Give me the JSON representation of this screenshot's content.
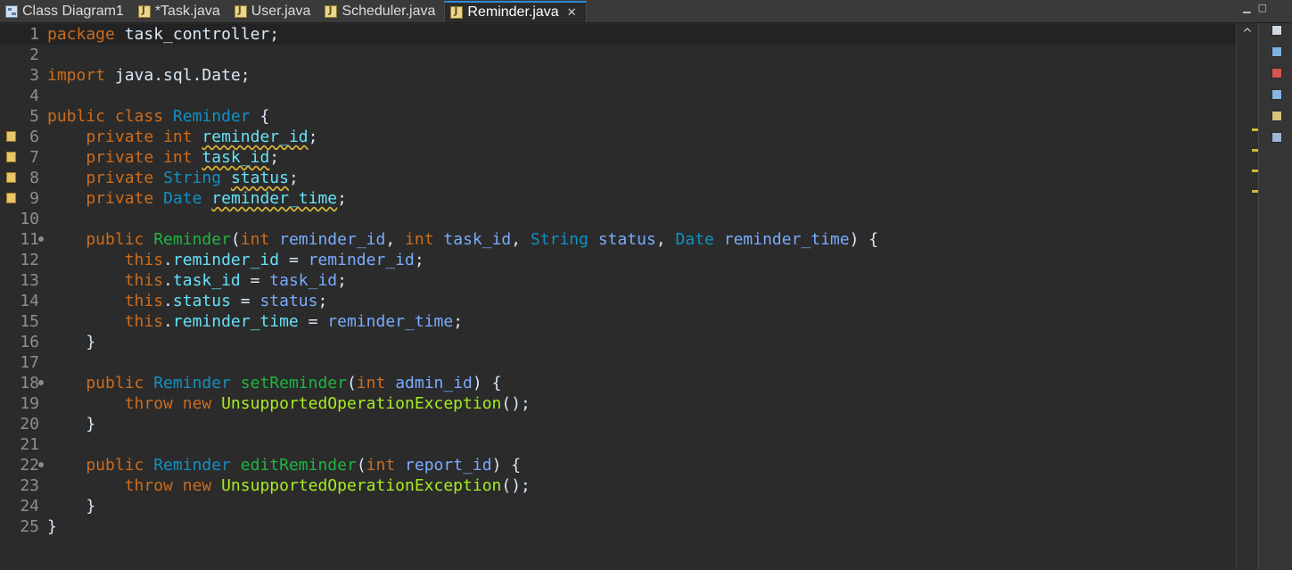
{
  "tabs": [
    {
      "label": "Class Diagram1",
      "icon": "class-diagram-icon",
      "active": false
    },
    {
      "label": "*Task.java",
      "icon": "java-file-icon",
      "active": false
    },
    {
      "label": "User.java",
      "icon": "java-file-icon",
      "active": false
    },
    {
      "label": "Scheduler.java",
      "icon": "java-file-icon",
      "active": false
    },
    {
      "label": "Reminder.java",
      "icon": "java-file-icon",
      "active": true,
      "close": "✕"
    }
  ],
  "colors": {
    "background": "#2b2b2b",
    "keyword": "#cc6c1d",
    "type": "#1290c3",
    "method": "#1eb540",
    "field": "#66e1f8",
    "parameter": "#79abff",
    "exception": "#a7ec21",
    "text": "#d9e8f7",
    "active_tab_accent": "#2f8ad8"
  },
  "editor": {
    "file": "Reminder.java",
    "lines": [
      {
        "n": "1",
        "tokens": [
          {
            "t": "package",
            "c": "kw"
          },
          {
            "t": " task_controller;",
            "c": "plain"
          }
        ]
      },
      {
        "n": "2",
        "tokens": []
      },
      {
        "n": "3",
        "tokens": [
          {
            "t": "import",
            "c": "kw"
          },
          {
            "t": " java.sql.Date;",
            "c": "plain"
          }
        ]
      },
      {
        "n": "4",
        "tokens": []
      },
      {
        "n": "5",
        "tokens": [
          {
            "t": "public",
            "c": "kw"
          },
          {
            "t": " ",
            "c": "plain"
          },
          {
            "t": "class",
            "c": "kw"
          },
          {
            "t": " ",
            "c": "plain"
          },
          {
            "t": "Reminder",
            "c": "ty"
          },
          {
            "t": " {",
            "c": "plain"
          }
        ]
      },
      {
        "n": "6",
        "marker": "warning",
        "tokens": [
          {
            "t": "    private",
            "c": "kw"
          },
          {
            "t": " ",
            "c": "plain"
          },
          {
            "t": "int",
            "c": "kw"
          },
          {
            "t": " ",
            "c": "plain"
          },
          {
            "t": "reminder_id",
            "c": "fld",
            "w": true
          },
          {
            "t": ";",
            "c": "plain"
          }
        ]
      },
      {
        "n": "7",
        "marker": "warning",
        "tokens": [
          {
            "t": "    private",
            "c": "kw"
          },
          {
            "t": " ",
            "c": "plain"
          },
          {
            "t": "int",
            "c": "kw"
          },
          {
            "t": " ",
            "c": "plain"
          },
          {
            "t": "task_id",
            "c": "fld",
            "w": true
          },
          {
            "t": ";",
            "c": "plain"
          }
        ]
      },
      {
        "n": "8",
        "marker": "warning",
        "tokens": [
          {
            "t": "    private",
            "c": "kw"
          },
          {
            "t": " ",
            "c": "plain"
          },
          {
            "t": "String",
            "c": "ty"
          },
          {
            "t": " ",
            "c": "plain"
          },
          {
            "t": "status",
            "c": "fld",
            "w": true
          },
          {
            "t": ";",
            "c": "plain"
          }
        ]
      },
      {
        "n": "9",
        "marker": "warning",
        "tokens": [
          {
            "t": "    private",
            "c": "kw"
          },
          {
            "t": " ",
            "c": "plain"
          },
          {
            "t": "Date",
            "c": "ty"
          },
          {
            "t": " ",
            "c": "plain"
          },
          {
            "t": "reminder_time",
            "c": "fld",
            "w": true
          },
          {
            "t": ";",
            "c": "plain"
          }
        ]
      },
      {
        "n": "10",
        "tokens": []
      },
      {
        "n": "11",
        "fold": true,
        "tokens": [
          {
            "t": "    public",
            "c": "kw"
          },
          {
            "t": " ",
            "c": "plain"
          },
          {
            "t": "Reminder",
            "c": "mt"
          },
          {
            "t": "(",
            "c": "plain"
          },
          {
            "t": "int",
            "c": "kw"
          },
          {
            "t": " ",
            "c": "plain"
          },
          {
            "t": "reminder_id",
            "c": "par"
          },
          {
            "t": ", ",
            "c": "plain"
          },
          {
            "t": "int",
            "c": "kw"
          },
          {
            "t": " ",
            "c": "plain"
          },
          {
            "t": "task_id",
            "c": "par"
          },
          {
            "t": ", ",
            "c": "plain"
          },
          {
            "t": "String",
            "c": "ty"
          },
          {
            "t": " ",
            "c": "plain"
          },
          {
            "t": "status",
            "c": "par"
          },
          {
            "t": ", ",
            "c": "plain"
          },
          {
            "t": "Date",
            "c": "ty"
          },
          {
            "t": " ",
            "c": "plain"
          },
          {
            "t": "reminder_time",
            "c": "par"
          },
          {
            "t": ") {",
            "c": "plain"
          }
        ]
      },
      {
        "n": "12",
        "tokens": [
          {
            "t": "        this",
            "c": "kw"
          },
          {
            "t": ".",
            "c": "plain"
          },
          {
            "t": "reminder_id",
            "c": "fld"
          },
          {
            "t": " = ",
            "c": "plain"
          },
          {
            "t": "reminder_id",
            "c": "par"
          },
          {
            "t": ";",
            "c": "plain"
          }
        ]
      },
      {
        "n": "13",
        "tokens": [
          {
            "t": "        this",
            "c": "kw"
          },
          {
            "t": ".",
            "c": "plain"
          },
          {
            "t": "task_id",
            "c": "fld"
          },
          {
            "t": " = ",
            "c": "plain"
          },
          {
            "t": "task_id",
            "c": "par"
          },
          {
            "t": ";",
            "c": "plain"
          }
        ]
      },
      {
        "n": "14",
        "tokens": [
          {
            "t": "        this",
            "c": "kw"
          },
          {
            "t": ".",
            "c": "plain"
          },
          {
            "t": "status",
            "c": "fld"
          },
          {
            "t": " = ",
            "c": "plain"
          },
          {
            "t": "status",
            "c": "par"
          },
          {
            "t": ";",
            "c": "plain"
          }
        ]
      },
      {
        "n": "15",
        "tokens": [
          {
            "t": "        this",
            "c": "kw"
          },
          {
            "t": ".",
            "c": "plain"
          },
          {
            "t": "reminder_time",
            "c": "fld"
          },
          {
            "t": " = ",
            "c": "plain"
          },
          {
            "t": "reminder_time",
            "c": "par"
          },
          {
            "t": ";",
            "c": "plain"
          }
        ]
      },
      {
        "n": "16",
        "tokens": [
          {
            "t": "    }",
            "c": "plain"
          }
        ]
      },
      {
        "n": "17",
        "tokens": []
      },
      {
        "n": "18",
        "fold": true,
        "tokens": [
          {
            "t": "    public",
            "c": "kw"
          },
          {
            "t": " ",
            "c": "plain"
          },
          {
            "t": "Reminder",
            "c": "ty"
          },
          {
            "t": " ",
            "c": "plain"
          },
          {
            "t": "setReminder",
            "c": "mt"
          },
          {
            "t": "(",
            "c": "plain"
          },
          {
            "t": "int",
            "c": "kw"
          },
          {
            "t": " ",
            "c": "plain"
          },
          {
            "t": "admin_id",
            "c": "par"
          },
          {
            "t": ") {",
            "c": "plain"
          }
        ]
      },
      {
        "n": "19",
        "tokens": [
          {
            "t": "        throw",
            "c": "kw"
          },
          {
            "t": " ",
            "c": "plain"
          },
          {
            "t": "new",
            "c": "kw"
          },
          {
            "t": " ",
            "c": "plain"
          },
          {
            "t": "UnsupportedOperationException",
            "c": "exc"
          },
          {
            "t": "();",
            "c": "plain"
          }
        ]
      },
      {
        "n": "20",
        "tokens": [
          {
            "t": "    }",
            "c": "plain"
          }
        ]
      },
      {
        "n": "21",
        "tokens": []
      },
      {
        "n": "22",
        "fold": true,
        "tokens": [
          {
            "t": "    public",
            "c": "kw"
          },
          {
            "t": " ",
            "c": "plain"
          },
          {
            "t": "Reminder",
            "c": "ty"
          },
          {
            "t": " ",
            "c": "plain"
          },
          {
            "t": "editReminder",
            "c": "mt"
          },
          {
            "t": "(",
            "c": "plain"
          },
          {
            "t": "int",
            "c": "kw"
          },
          {
            "t": " ",
            "c": "plain"
          },
          {
            "t": "report_id",
            "c": "par"
          },
          {
            "t": ") {",
            "c": "plain"
          }
        ]
      },
      {
        "n": "23",
        "tokens": [
          {
            "t": "        throw",
            "c": "kw"
          },
          {
            "t": " ",
            "c": "plain"
          },
          {
            "t": "new",
            "c": "kw"
          },
          {
            "t": " ",
            "c": "plain"
          },
          {
            "t": "UnsupportedOperationException",
            "c": "exc"
          },
          {
            "t": "();",
            "c": "plain"
          }
        ]
      },
      {
        "n": "24",
        "tokens": [
          {
            "t": "    }",
            "c": "plain"
          }
        ]
      },
      {
        "n": "25",
        "tokens": [
          {
            "t": "}",
            "c": "plain"
          }
        ]
      }
    ]
  },
  "overview_ruler": {
    "scroll_up_icon": "^",
    "warning_marks": 4
  },
  "sidebar_icons": [
    "outline-icon",
    "hierarchy-icon",
    "debug-icon",
    "javadoc-icon",
    "declaration-icon",
    "console-icon"
  ]
}
